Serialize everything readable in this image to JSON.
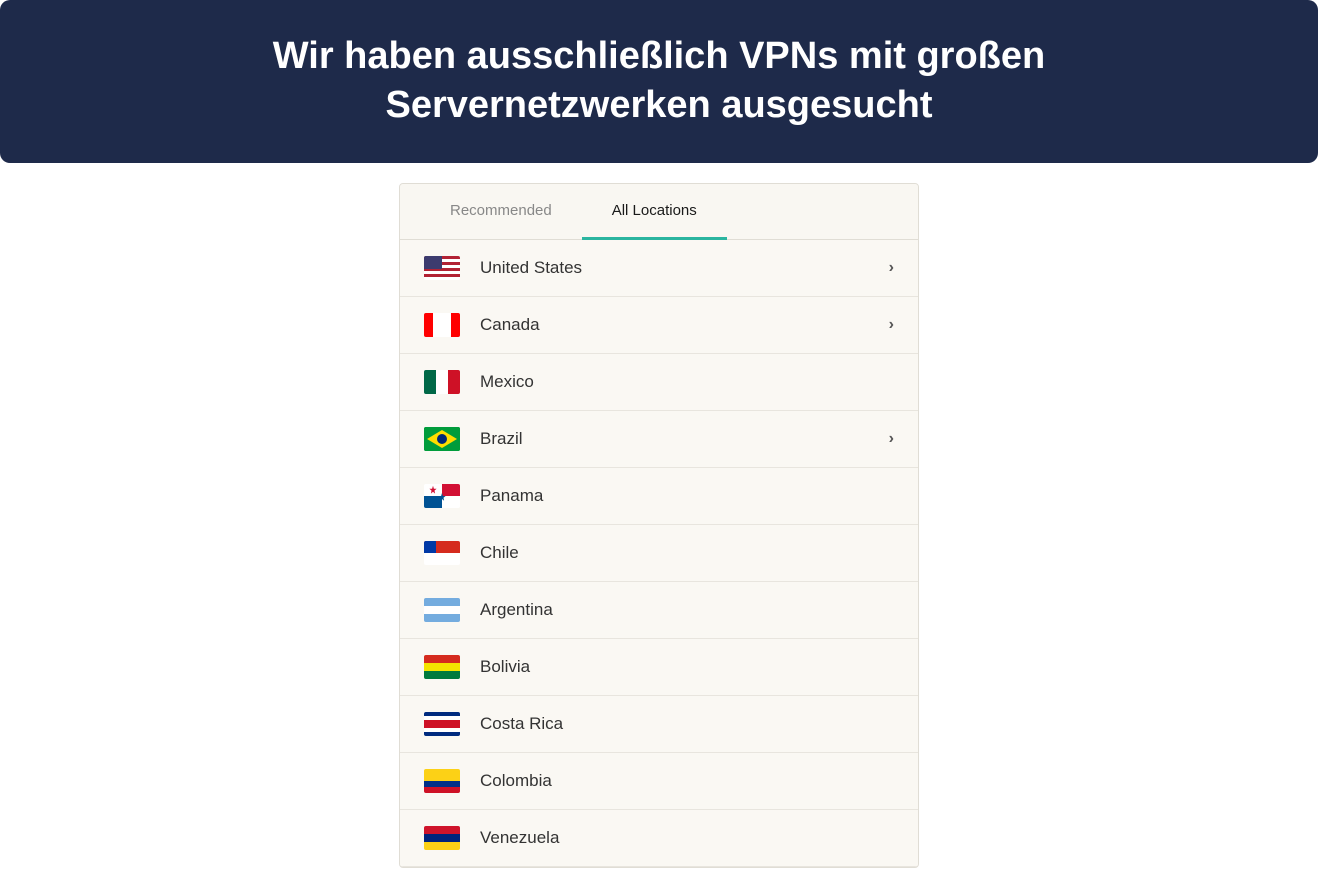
{
  "header": {
    "title_line1": "Wir haben ausschließlich VPNs mit großen",
    "title_line2": "Servernetzwerken ausgesucht"
  },
  "tabs": [
    {
      "id": "recommended",
      "label": "Recommended",
      "active": false
    },
    {
      "id": "all-locations",
      "label": "All Locations",
      "active": true
    }
  ],
  "locations": [
    {
      "id": "us",
      "name": "United States",
      "flag_class": "flag-us",
      "flag_emoji": "🇺🇸",
      "has_arrow": true
    },
    {
      "id": "ca",
      "name": "Canada",
      "flag_class": "flag-ca",
      "flag_emoji": "🇨🇦",
      "has_arrow": true
    },
    {
      "id": "mx",
      "name": "Mexico",
      "flag_class": "flag-mx",
      "flag_emoji": "🇲🇽",
      "has_arrow": false
    },
    {
      "id": "br",
      "name": "Brazil",
      "flag_class": "flag-br",
      "flag_emoji": "🇧🇷",
      "has_arrow": true
    },
    {
      "id": "pa",
      "name": "Panama",
      "flag_class": "flag-pa",
      "flag_emoji": "🇵🇦",
      "has_arrow": false
    },
    {
      "id": "cl",
      "name": "Chile",
      "flag_class": "flag-cl",
      "flag_emoji": "🇨🇱",
      "has_arrow": false
    },
    {
      "id": "ar",
      "name": "Argentina",
      "flag_class": "flag-ar",
      "flag_emoji": "🇦🇷",
      "has_arrow": false
    },
    {
      "id": "bo",
      "name": "Bolivia",
      "flag_class": "flag-bo",
      "flag_emoji": "🇧🇴",
      "has_arrow": false
    },
    {
      "id": "cr",
      "name": "Costa Rica",
      "flag_class": "flag-cr",
      "flag_emoji": "🇨🇷",
      "has_arrow": false
    },
    {
      "id": "co",
      "name": "Colombia",
      "flag_class": "flag-co",
      "flag_emoji": "🇨🇴",
      "has_arrow": false
    },
    {
      "id": "ve",
      "name": "Venezuela",
      "flag_class": "flag-ve",
      "flag_emoji": "🇻🇪",
      "has_arrow": false
    }
  ],
  "chevron_symbol": "›",
  "colors": {
    "header_bg": "#1e2a4a",
    "header_text": "#ffffff",
    "active_tab_underline": "#2bb5a0",
    "panel_bg": "#faf8f3"
  }
}
